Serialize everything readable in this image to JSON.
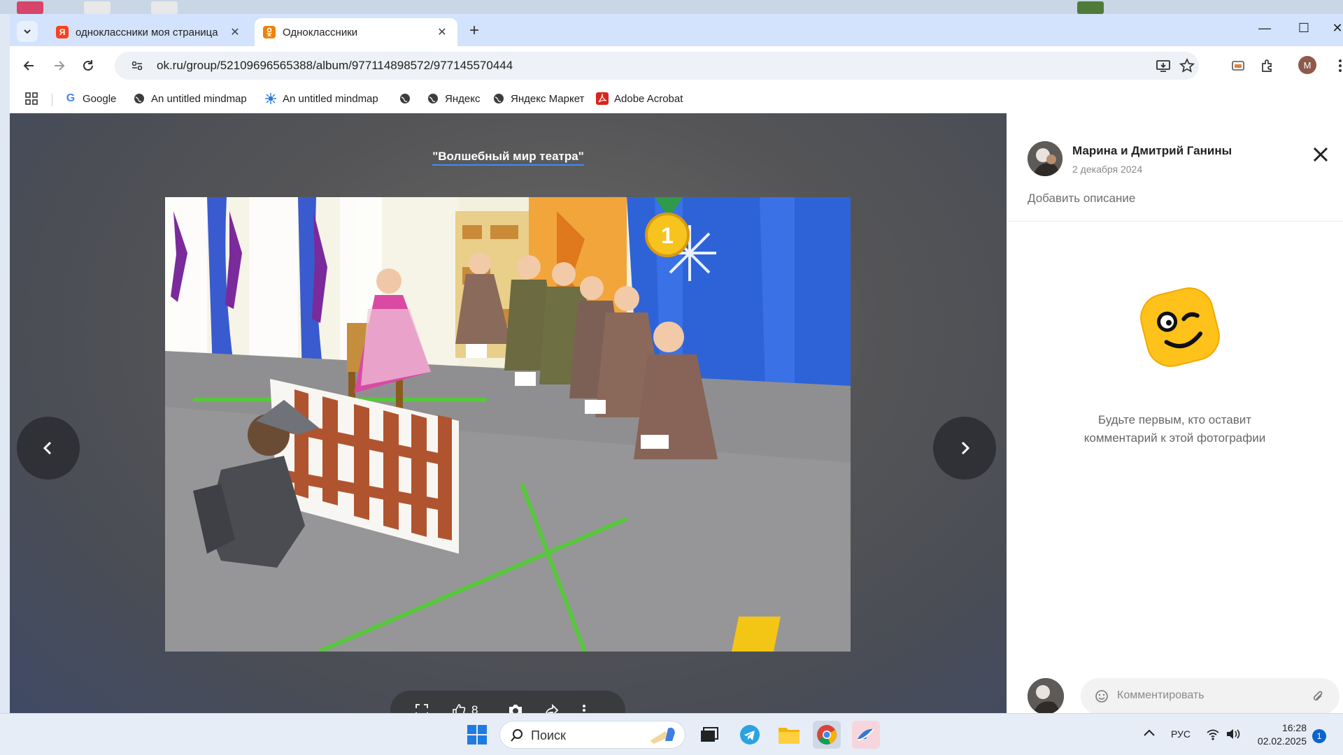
{
  "browser": {
    "tabs": [
      {
        "title": "одноклассники моя страница",
        "active": false,
        "favicon": "yandex-icon",
        "color": "#fc3f1d"
      },
      {
        "title": "Одноклассники",
        "active": true,
        "favicon": "odnoklassniki-icon",
        "color": "#ee8208"
      }
    ],
    "address": "ok.ru/group/52109696565388/album/977114898572/977145570444",
    "profile_initial": "M",
    "bookmarks": [
      {
        "label": "",
        "icon": "apps-grid-icon"
      },
      {
        "label": "Google",
        "icon": "google-icon"
      },
      {
        "label": "An untitled mindmap",
        "icon": "globe-icon"
      },
      {
        "label": "An untitled mindmap",
        "icon": "mindmap-icon"
      },
      {
        "label": "",
        "icon": "globe-icon"
      },
      {
        "label": "Яндекс",
        "icon": "globe-icon"
      },
      {
        "label": "Яндекс Маркет",
        "icon": "globe-icon"
      },
      {
        "label": "Adobe Acrobat",
        "icon": "acrobat-icon"
      }
    ]
  },
  "viewer": {
    "album_title": "\"Волшебный мир театра\"",
    "like_count": "8",
    "medal_number": "1"
  },
  "side_panel": {
    "author_name": "Марина и Дмитрий Ганины",
    "date": "2 декабря 2024",
    "add_description": "Добавить описание",
    "empty_line1": "Будьте первым, кто оставит",
    "empty_line2": "комментарий к этой фотографии",
    "comment_placeholder": "Комментировать"
  },
  "taskbar": {
    "search_label": "Поиск",
    "language": "РУС",
    "time": "16:28",
    "date": "02.02.2025",
    "notification_count": "1"
  },
  "colors": {
    "accent_blue": "#3d8bff",
    "ok_orange": "#ee8208",
    "emoji_yellow": "#ffc21a"
  }
}
